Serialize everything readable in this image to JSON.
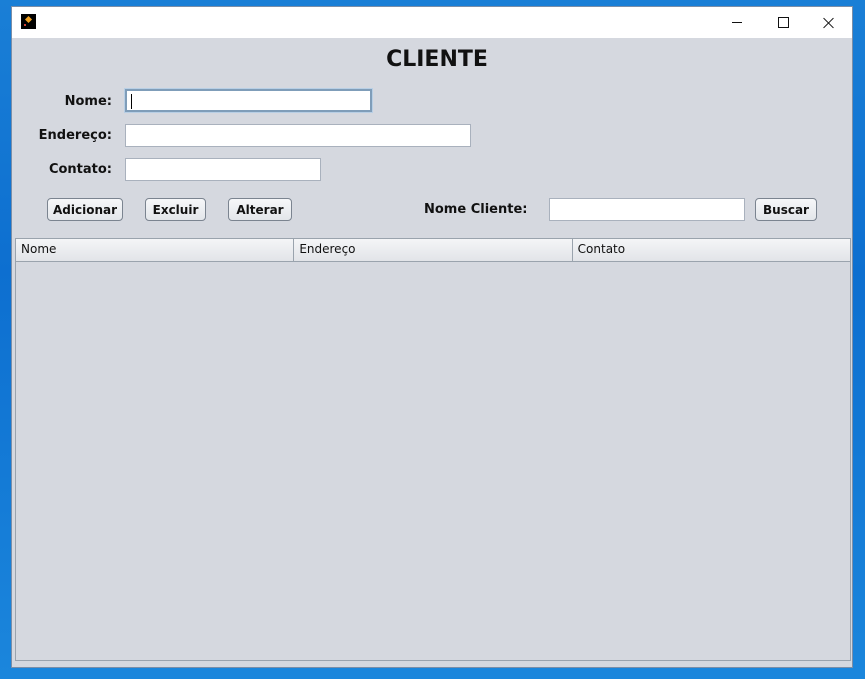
{
  "window": {
    "app_icon": "app-star-icon",
    "controls": {
      "minimize_icon": "minimize-icon",
      "maximize_icon": "maximize-icon",
      "close_icon": "close-icon"
    }
  },
  "form": {
    "title": "CLIENTE",
    "nome_label": "Nome:",
    "nome_value": "",
    "endereco_label": "Endereço:",
    "endereco_value": "",
    "contato_label": "Contato:",
    "contato_value": ""
  },
  "actions": {
    "adicionar": "Adicionar",
    "excluir": "Excluir",
    "alterar": "Alterar"
  },
  "search": {
    "label": "Nome Cliente:",
    "value": "",
    "button": "Buscar"
  },
  "table": {
    "columns": [
      "Nome",
      "Endereço",
      "Contato"
    ],
    "rows": []
  }
}
